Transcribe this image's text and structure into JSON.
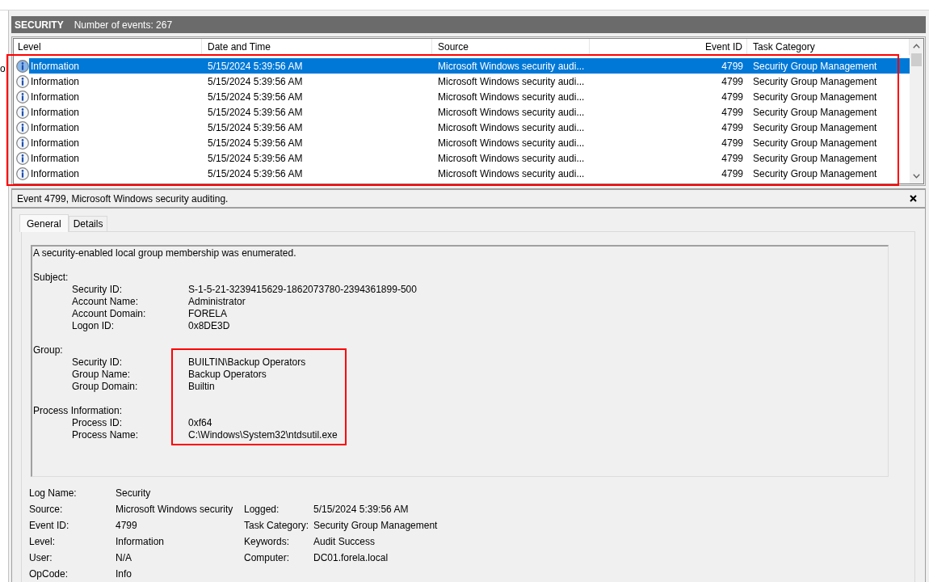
{
  "left_pane": {
    "text": "o"
  },
  "log_header": {
    "title": "SECURITY",
    "event_count": "Number of events: 267"
  },
  "events_table": {
    "highlighted": true,
    "columns": [
      "Level",
      "Date and Time",
      "Source",
      "Event ID",
      "Task Category"
    ],
    "rows": [
      {
        "level": "Information",
        "date_time": "5/15/2024 5:39:56 AM",
        "source": "Microsoft Windows security audi...",
        "event_id": "4799",
        "task_category": "Security Group Management",
        "selected": true
      },
      {
        "level": "Information",
        "date_time": "5/15/2024 5:39:56 AM",
        "source": "Microsoft Windows security audi...",
        "event_id": "4799",
        "task_category": "Security Group Management",
        "selected": false
      },
      {
        "level": "Information",
        "date_time": "5/15/2024 5:39:56 AM",
        "source": "Microsoft Windows security audi...",
        "event_id": "4799",
        "task_category": "Security Group Management",
        "selected": false
      },
      {
        "level": "Information",
        "date_time": "5/15/2024 5:39:56 AM",
        "source": "Microsoft Windows security audi...",
        "event_id": "4799",
        "task_category": "Security Group Management",
        "selected": false
      },
      {
        "level": "Information",
        "date_time": "5/15/2024 5:39:56 AM",
        "source": "Microsoft Windows security audi...",
        "event_id": "4799",
        "task_category": "Security Group Management",
        "selected": false
      },
      {
        "level": "Information",
        "date_time": "5/15/2024 5:39:56 AM",
        "source": "Microsoft Windows security audi...",
        "event_id": "4799",
        "task_category": "Security Group Management",
        "selected": false
      },
      {
        "level": "Information",
        "date_time": "5/15/2024 5:39:56 AM",
        "source": "Microsoft Windows security audi...",
        "event_id": "4799",
        "task_category": "Security Group Management",
        "selected": false
      },
      {
        "level": "Information",
        "date_time": "5/15/2024 5:39:56 AM",
        "source": "Microsoft Windows security audi...",
        "event_id": "4799",
        "task_category": "Security Group Management",
        "selected": false
      }
    ]
  },
  "event_details": {
    "title": "Event 4799, Microsoft Windows security auditing.",
    "tabs": [
      {
        "label": "General",
        "selected": true
      },
      {
        "label": "Details",
        "selected": false
      }
    ],
    "description": {
      "summary": "A security-enabled local group membership was enumerated.",
      "sections": [
        {
          "heading": "Subject:",
          "fields": [
            {
              "label": "Security ID:",
              "value": "S-1-5-21-3239415629-1862073780-2394361899-500"
            },
            {
              "label": "Account Name:",
              "value": "Administrator"
            },
            {
              "label": "Account Domain:",
              "value": "FORELA"
            },
            {
              "label": "Logon ID:",
              "value": "0x8DE3D"
            }
          ]
        },
        {
          "heading": "Group:",
          "highlighted": true,
          "fields": [
            {
              "label": "Security ID:",
              "value": "BUILTIN\\Backup Operators"
            },
            {
              "label": "Group Name:",
              "value": "Backup Operators"
            },
            {
              "label": "Group Domain:",
              "value": "Builtin"
            }
          ]
        },
        {
          "heading": "Process Information:",
          "highlighted": true,
          "fields": [
            {
              "label": "Process ID:",
              "value": "0xf64"
            },
            {
              "label": "Process Name:",
              "value": "C:\\Windows\\System32\\ntdsutil.exe"
            }
          ]
        }
      ]
    },
    "properties": [
      {
        "left": {
          "label": "Log Name:",
          "value": "Security"
        }
      },
      {
        "left": {
          "label": "Source:",
          "value": "Microsoft Windows security"
        },
        "right": {
          "label": "Logged:",
          "value": "5/15/2024 5:39:56 AM"
        }
      },
      {
        "left": {
          "label": "Event ID:",
          "value": "4799"
        },
        "right": {
          "label": "Task Category:",
          "value": "Security Group Management"
        }
      },
      {
        "left": {
          "label": "Level:",
          "value": "Information"
        },
        "right": {
          "label": "Keywords:",
          "value": "Audit Success"
        }
      },
      {
        "left": {
          "label": "User:",
          "value": "N/A"
        },
        "right": {
          "label": "Computer:",
          "value": "DC01.forela.local"
        }
      },
      {
        "left": {
          "label": "OpCode:",
          "value": "Info"
        }
      }
    ]
  }
}
